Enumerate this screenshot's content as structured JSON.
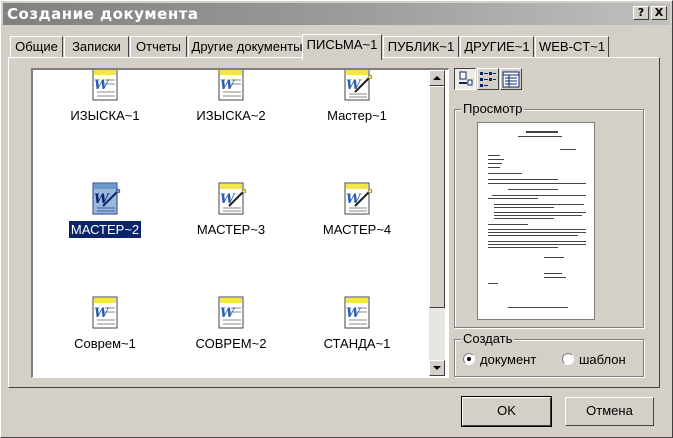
{
  "window": {
    "title": "Создание документа"
  },
  "titlebar": {
    "help_label": "?",
    "close_label": "X"
  },
  "tabs": [
    {
      "label": "Общие",
      "active": false
    },
    {
      "label": "Записки",
      "active": false
    },
    {
      "label": "Отчеты",
      "active": false
    },
    {
      "label": "Другие документы",
      "active": false
    },
    {
      "label": "ПИСЬМА~1",
      "active": true
    },
    {
      "label": "ПУБЛИК~1",
      "active": false
    },
    {
      "label": "ДРУГИЕ~1",
      "active": false
    },
    {
      "label": "WEB-CT~1",
      "active": false
    }
  ],
  "files": [
    {
      "label": "ИЗЫСКА~1",
      "icon": "word-document-icon",
      "selected": false
    },
    {
      "label": "ИЗЫСКА~2",
      "icon": "word-document-icon",
      "selected": false
    },
    {
      "label": "Мастер~1",
      "icon": "word-wizard-icon",
      "selected": false
    },
    {
      "label": "МАСТЕР~2",
      "icon": "word-wizard-icon",
      "selected": true
    },
    {
      "label": "МАСТЕР~3",
      "icon": "word-wizard-icon",
      "selected": false
    },
    {
      "label": "МАСТЕР~4",
      "icon": "word-wizard-icon",
      "selected": false
    },
    {
      "label": "Соврем~1",
      "icon": "word-document-icon",
      "selected": false
    },
    {
      "label": "СОВРЕМ~2",
      "icon": "word-document-icon",
      "selected": false
    },
    {
      "label": "СТАНДА~1",
      "icon": "word-document-icon",
      "selected": false
    }
  ],
  "view_buttons": [
    {
      "name": "large-icons-view-button",
      "pressed": true
    },
    {
      "name": "list-view-button",
      "pressed": false
    },
    {
      "name": "details-view-button",
      "pressed": false
    }
  ],
  "preview": {
    "title": "Просмотр"
  },
  "create": {
    "title": "Создать",
    "document_label": "документ",
    "template_label": "шаблон",
    "selected": "document"
  },
  "buttons": {
    "ok": "OK",
    "cancel": "Отмена"
  },
  "colors": {
    "face": "#d4d0c8",
    "selection": "#0a246a",
    "word_blue": "#2a5fb0",
    "highlight_yellow": "#f4e64a"
  }
}
